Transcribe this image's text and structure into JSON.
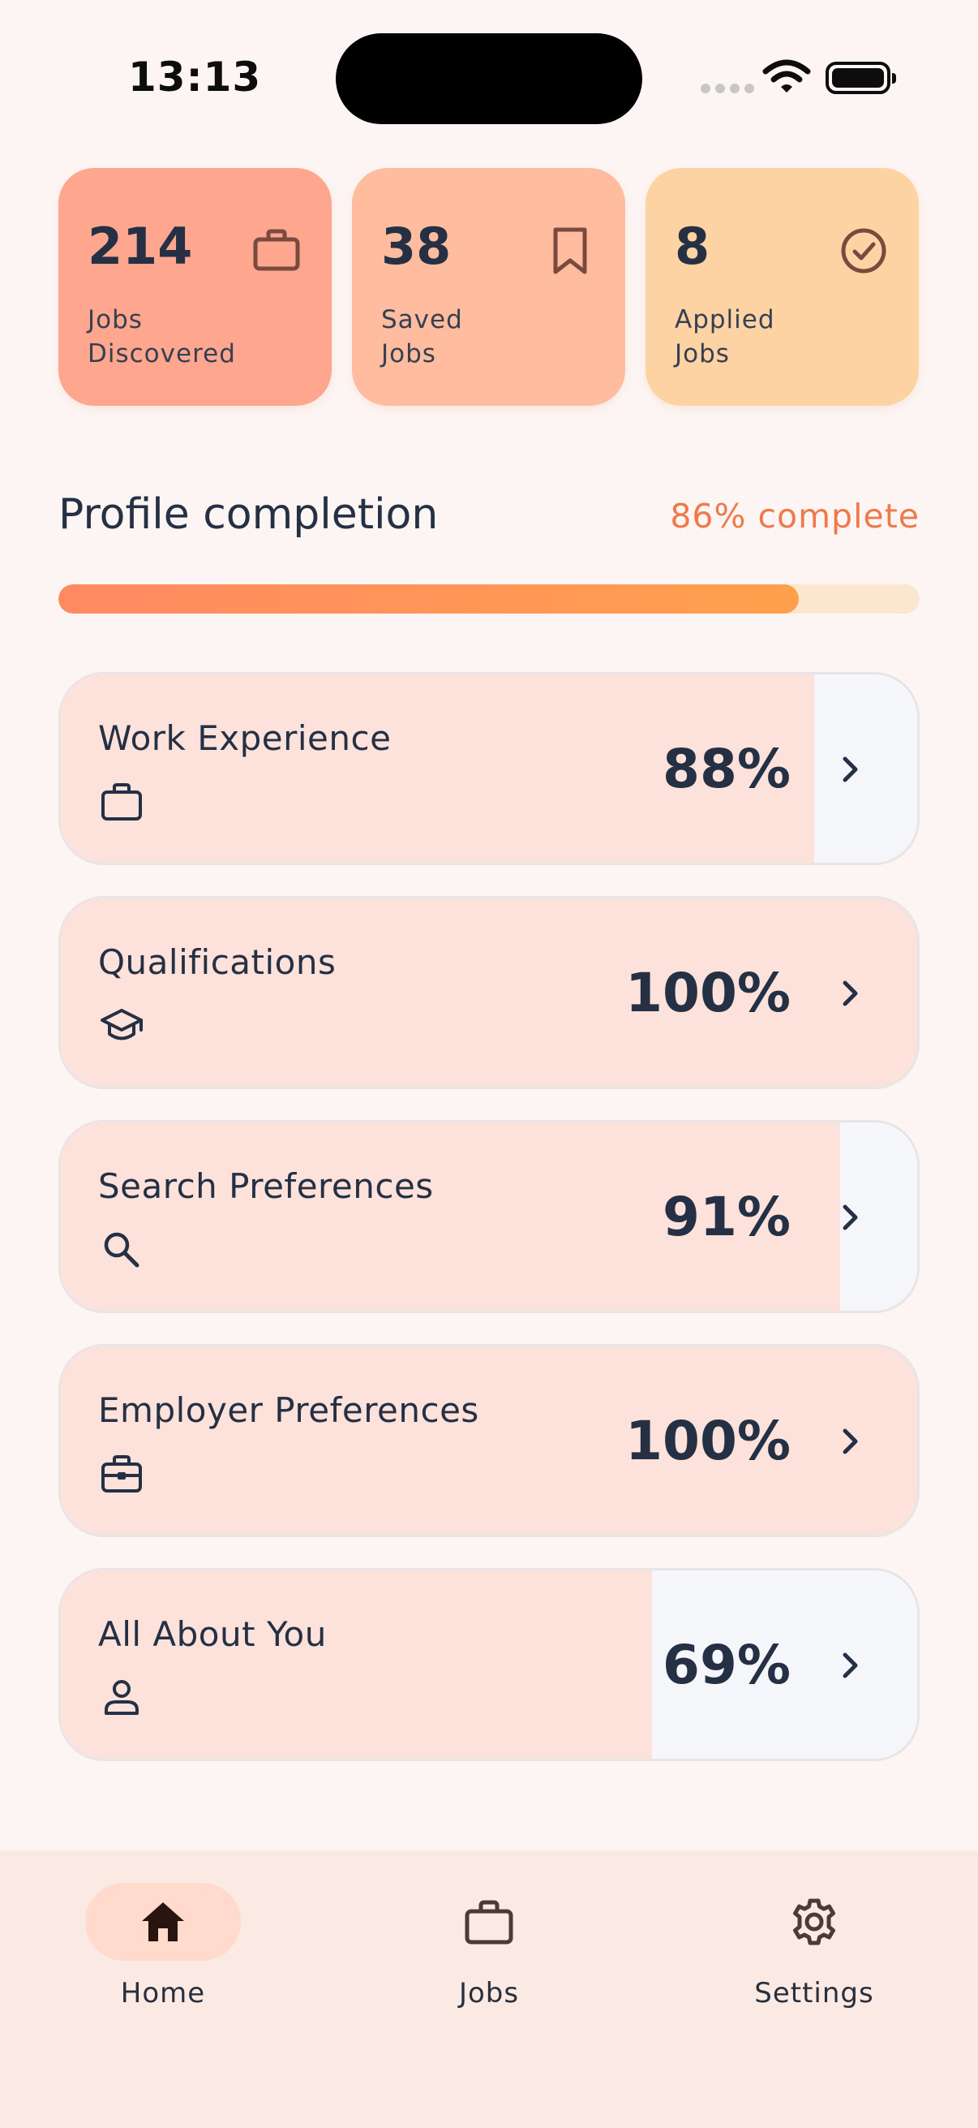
{
  "status_bar": {
    "time": "13:13"
  },
  "stats": [
    {
      "value": "214",
      "label": "Jobs\nDiscovered",
      "icon": "briefcase-icon",
      "color": "#ffa68f"
    },
    {
      "value": "38",
      "label": "Saved\nJobs",
      "icon": "bookmark-icon",
      "color": "#ffbc9f"
    },
    {
      "value": "8",
      "label": "Applied\nJobs",
      "icon": "check-circle-icon",
      "color": "#fed3a4"
    }
  ],
  "profile": {
    "title": "Profile completion",
    "percent_label": "86% complete",
    "progress": 0.86,
    "sections": [
      {
        "title": "Work Experience",
        "percent": "88%",
        "fill": 0.88,
        "icon": "briefcase-icon"
      },
      {
        "title": "Qualifications",
        "percent": "100%",
        "fill": 1.0,
        "icon": "graduation-cap-icon"
      },
      {
        "title": "Search Preferences",
        "percent": "91%",
        "fill": 0.91,
        "icon": "search-icon"
      },
      {
        "title": "Employer Preferences",
        "percent": "100%",
        "fill": 1.0,
        "icon": "toolbox-icon"
      },
      {
        "title": "All About You",
        "percent": "69%",
        "fill": 0.69,
        "icon": "person-icon"
      }
    ]
  },
  "nav": {
    "items": [
      {
        "label": "Home",
        "icon": "home-icon",
        "active": true
      },
      {
        "label": "Jobs",
        "icon": "briefcase-icon",
        "active": false
      },
      {
        "label": "Settings",
        "icon": "gear-icon",
        "active": false
      }
    ]
  },
  "colors": {
    "accent": "#ee7a4c",
    "text": "#253044",
    "row_fill": "#fce2da",
    "row_empty": "#f4f6fa"
  }
}
